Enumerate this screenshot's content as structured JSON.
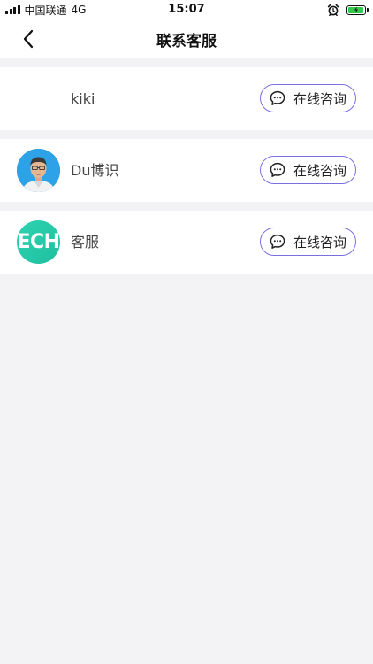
{
  "status_bar": {
    "carrier": "中国联通",
    "network": "4G",
    "time": "15:07",
    "battery_level": 0.85,
    "icons": [
      "signal-icon",
      "alarm-icon",
      "battery-icon"
    ]
  },
  "nav": {
    "title": "联系客服",
    "back_icon": "chevron-left-icon"
  },
  "contacts": [
    {
      "name": "kiki",
      "avatar": "none",
      "action_label": "在线咨询",
      "action_icon": "chat-bubble-icon"
    },
    {
      "name": "Du博识",
      "avatar": "photo",
      "action_label": "在线咨询",
      "action_icon": "chat-bubble-icon"
    },
    {
      "name": "客服",
      "avatar": "logo",
      "logo_text": "ECH",
      "action_label": "在线咨询",
      "action_icon": "chat-bubble-icon"
    }
  ],
  "colors": {
    "background": "#f3f3f5",
    "accent_border": "#7b6fe0",
    "logo_green": "#2dd3b0",
    "photo_blue": "#2ea2e6",
    "battery_green": "#33c94a"
  }
}
